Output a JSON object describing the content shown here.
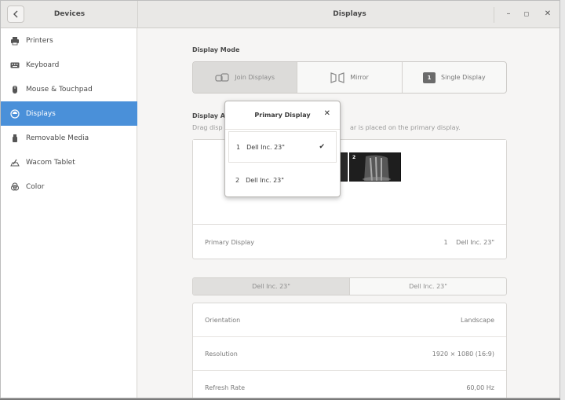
{
  "header": {
    "back_icon": "chevron-left-icon",
    "left_title": "Devices",
    "main_title": "Displays",
    "minimize": "–",
    "maximize": "◻",
    "close": "✕"
  },
  "sidebar": {
    "items": [
      {
        "label": "Printers",
        "icon": "printer-icon"
      },
      {
        "label": "Keyboard",
        "icon": "keyboard-icon"
      },
      {
        "label": "Mouse & Touchpad",
        "icon": "mouse-icon"
      },
      {
        "label": "Displays",
        "icon": "display-icon",
        "active": true
      },
      {
        "label": "Removable Media",
        "icon": "usb-icon"
      },
      {
        "label": "Wacom Tablet",
        "icon": "tablet-icon"
      },
      {
        "label": "Color",
        "icon": "color-icon"
      }
    ]
  },
  "display_mode": {
    "heading": "Display Mode",
    "options": [
      {
        "label": "Join Displays",
        "icon": "join-displays-icon",
        "selected": true
      },
      {
        "label": "Mirror",
        "icon": "mirror-icon"
      },
      {
        "label": "Single Display",
        "icon": "single-display-icon",
        "badge": "1"
      }
    ]
  },
  "arrangement": {
    "heading_visible": "Display A",
    "hint_left": "Drag disp",
    "hint_right": "ar is placed on the primary display.",
    "monitor_2_label": "2",
    "primary_label": "Primary Display",
    "primary_num": "1",
    "primary_value": "Dell Inc. 23\""
  },
  "tabs": [
    {
      "label": "Dell Inc. 23\"",
      "selected": true
    },
    {
      "label": "Dell Inc. 23\""
    }
  ],
  "properties": [
    {
      "label": "Orientation",
      "value": "Landscape"
    },
    {
      "label": "Resolution",
      "value": "1920 × 1080 (16:9)"
    },
    {
      "label": "Refresh Rate",
      "value": "60,00 Hz"
    }
  ],
  "popover": {
    "title": "Primary Display",
    "close": "✕",
    "items": [
      {
        "num": "1",
        "label": "Dell Inc. 23\"",
        "checked": true,
        "check": "✔"
      },
      {
        "num": "2",
        "label": "Dell Inc. 23\""
      }
    ]
  },
  "colors": {
    "accent": "#4a90d9",
    "window_bg": "#f6f5f4",
    "sidebar_bg": "#ffffff"
  }
}
